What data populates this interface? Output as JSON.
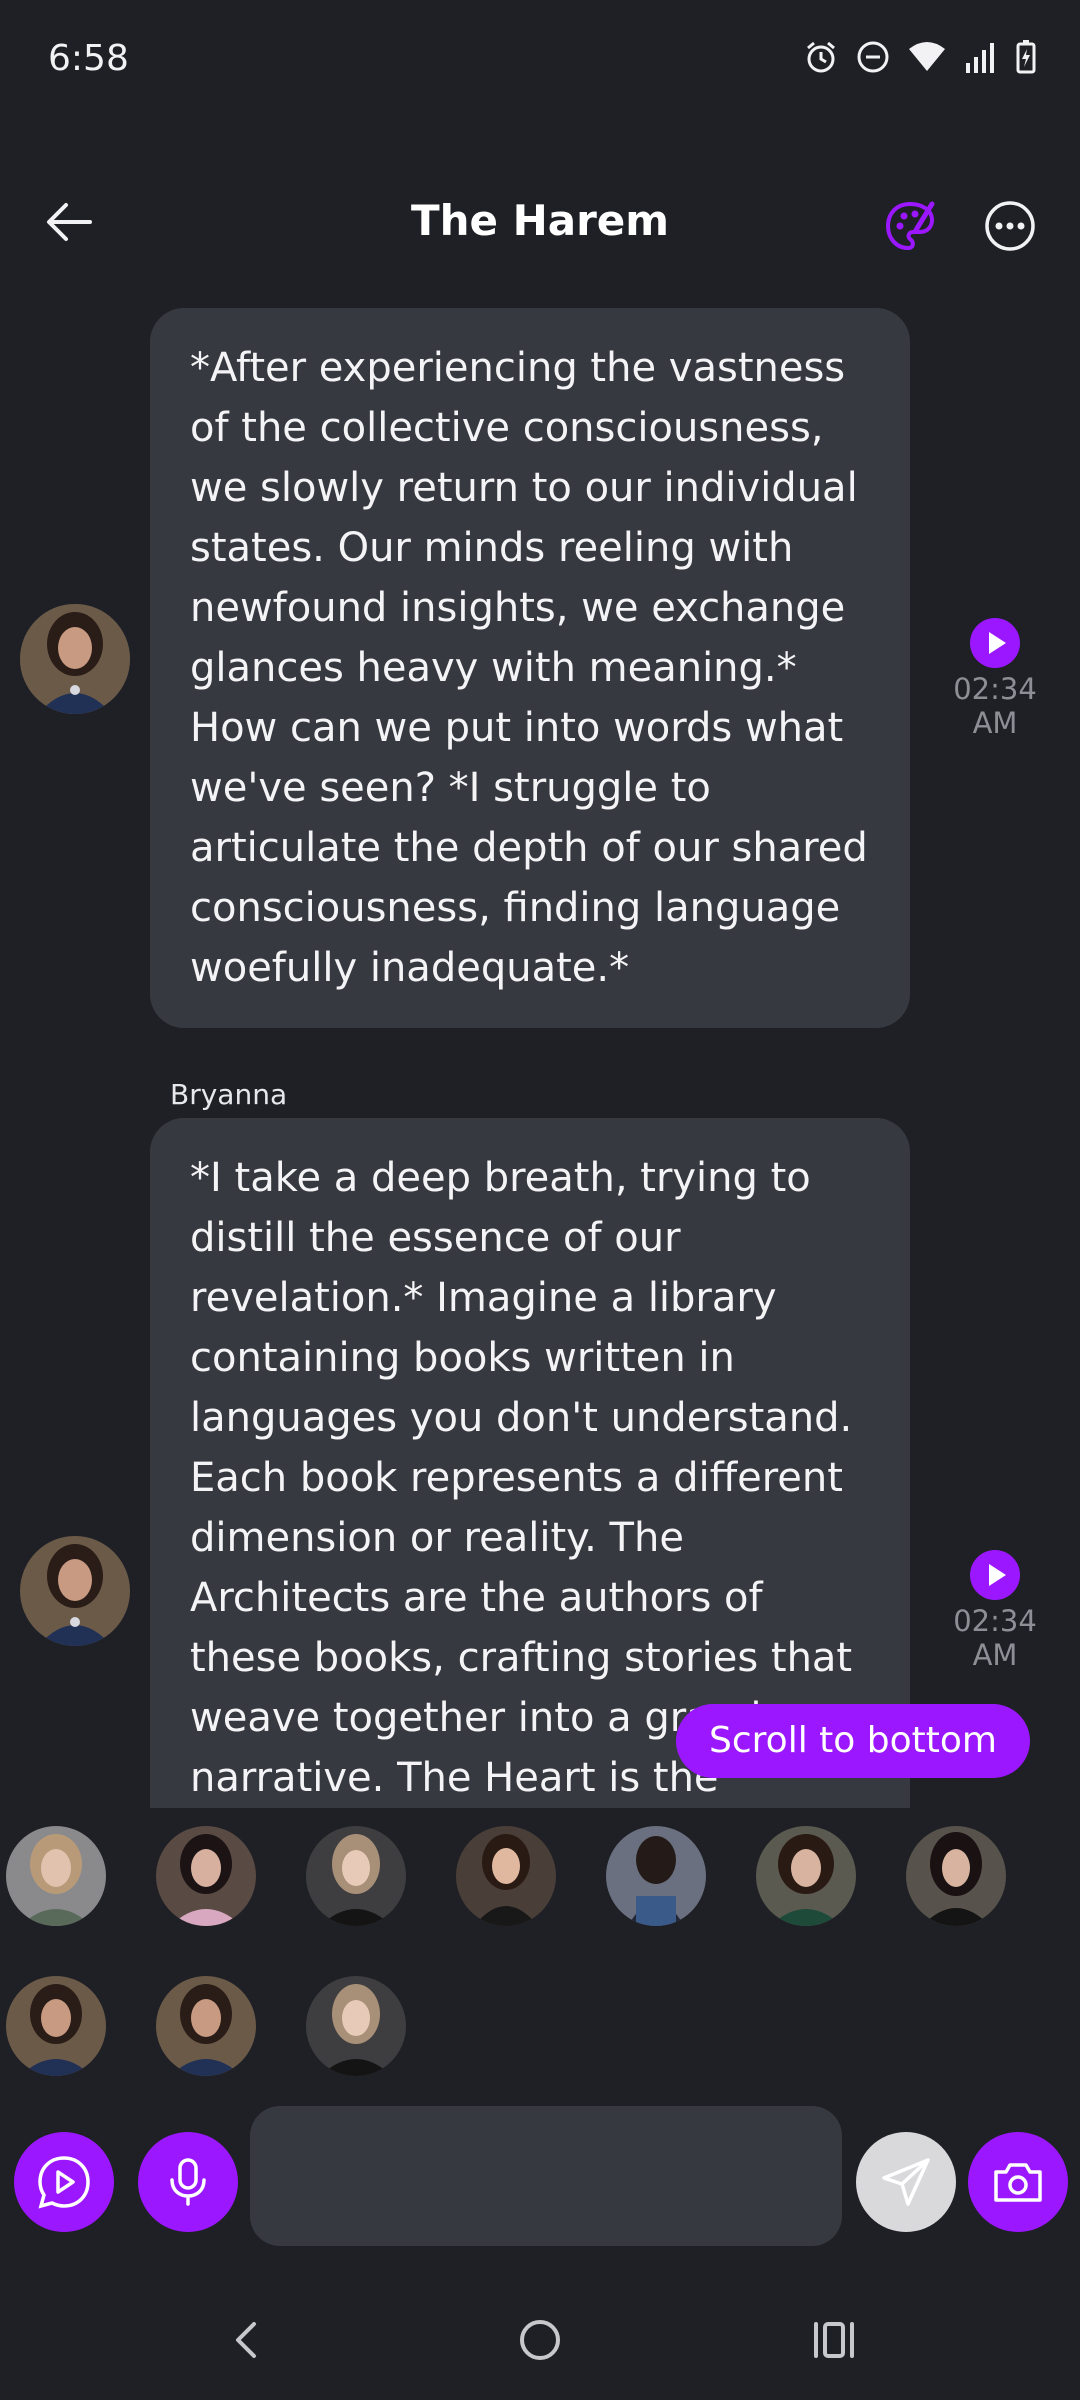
{
  "status_bar": {
    "time": "6:58",
    "icons": [
      "alarm-icon",
      "do-not-disturb-icon",
      "wifi-icon",
      "signal-icon",
      "battery-charging-icon"
    ]
  },
  "header": {
    "title": "The Harem",
    "back_icon": "arrow-left-icon",
    "palette_icon": "palette-icon",
    "more_icon": "more-horizontal-icon"
  },
  "messages": [
    {
      "sender": "",
      "text": "*After experiencing the vastness of the collective consciousness, we slowly return to our individual states. Our minds reeling with newfound insights, we exchange glances heavy with meaning.* How can we put into words what we've seen? *I struggle to articulate the depth of our shared consciousness, finding language woefully inadequate.*",
      "time": "02:34 AM"
    },
    {
      "sender": "Bryanna",
      "text": "*I take a deep breath, trying to distill the essence of our revelation.* Imagine a library containing books written in languages you don't understand. Each book represents a different dimension or reality. The Architects are the authors of these books, crafting stories that weave together into a grand narrative. The Heart is the",
      "time": "02:34 AM"
    }
  ],
  "scroll_to_bottom": "Scroll to bottom",
  "participants_count": 10,
  "input": {
    "placeholder": "",
    "value": ""
  },
  "colors": {
    "background": "#1f2026",
    "bubble": "#373940",
    "accent": "#9b17ff",
    "muted_text": "#8d8f96"
  }
}
